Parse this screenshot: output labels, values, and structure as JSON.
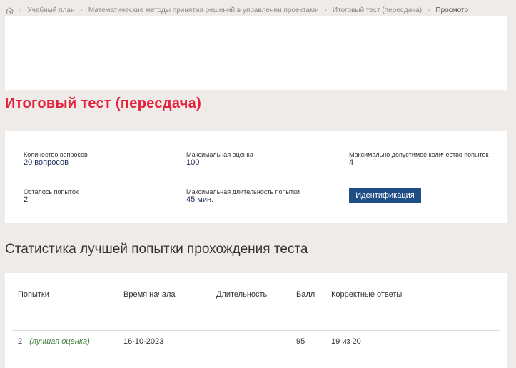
{
  "breadcrumb": {
    "items": [
      {
        "label": "Учебный план"
      },
      {
        "label": "Математические методы принятия решений в управлении проектами"
      },
      {
        "label": "Итоговый тест (пересдача)"
      },
      {
        "label": "Просмотр"
      }
    ]
  },
  "page": {
    "title": "Итоговый тест (пересдача)"
  },
  "info": {
    "questions_label": "Количество вопросов",
    "questions_value": "20 вопросов",
    "max_score_label": "Максимальная оценка",
    "max_score_value": "100",
    "max_attempts_label": "Максимально допустимое количество попыток",
    "max_attempts_value": "4",
    "attempts_left_label": "Осталось попыток",
    "attempts_left_value": "2",
    "max_duration_label": "Максимальная длительность попытки",
    "max_duration_value": "45 мин.",
    "identify_button": "Идентификация"
  },
  "stats": {
    "section_title": "Статистика лучшей попытки прохождения теста",
    "columns": [
      "Попытки",
      "Время начала",
      "Длительность",
      "Балл",
      "Корректные ответы"
    ],
    "rows": [
      {
        "attempt": "2",
        "note": "(лучшая оценка)",
        "start": "16-10-2023",
        "duration": "",
        "score": "95",
        "correct": "19 из 20"
      }
    ]
  },
  "colors": {
    "background": "#eeebe8",
    "title_red": "#e5203a",
    "button_blue": "#1f4e86",
    "value_navy": "#1d2b5a",
    "best_note_green": "#3a7d3a"
  }
}
